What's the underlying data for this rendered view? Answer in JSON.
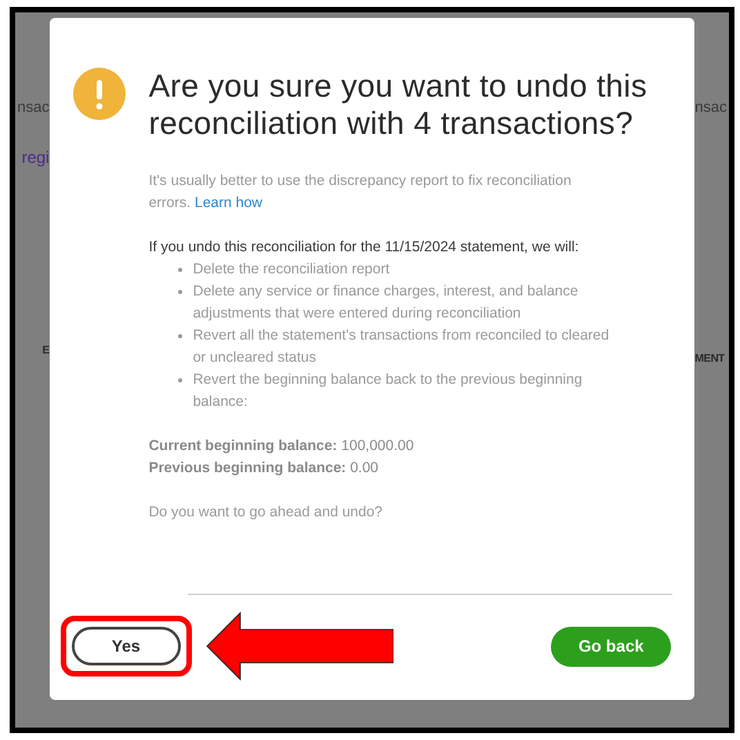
{
  "background": {
    "left_texts": [
      {
        "text": "nsac",
        "kind": "plain"
      },
      {
        "text": "regi",
        "kind": "link"
      },
      {
        "text": "E",
        "kind": "header"
      }
    ],
    "right_texts": [
      {
        "text": "nsac",
        "kind": "plain"
      },
      {
        "text": "MENT",
        "kind": "header"
      }
    ]
  },
  "dialog": {
    "title": "Are you sure you want to undo this reconciliation with 4 transactions?",
    "intro": "It's usually better to use the discrepancy report to fix reconciliation errors.",
    "intro_link": "Learn how",
    "lead": "If you undo this reconciliation for the 11/15/2024 statement, we will:",
    "bullets": [
      "Delete the reconciliation report",
      "Delete any service or finance charges, interest, and balance adjustments that were entered during reconciliation",
      "Revert all the statement's transactions from reconciled to cleared or uncleared status",
      "Revert the beginning balance back to the previous beginning balance:"
    ],
    "balances": [
      "**Current beginning balance:** 100,000.00",
      "**Previous beginning balance:** 0.00"
    ],
    "question": "Do you want to go ahead and undo?",
    "buttons": [
      {
        "label": "Yes",
        "kind": "secondary",
        "highlighted": true
      },
      {
        "label": "Go back",
        "kind": "primary",
        "highlighted": false
      }
    ]
  }
}
